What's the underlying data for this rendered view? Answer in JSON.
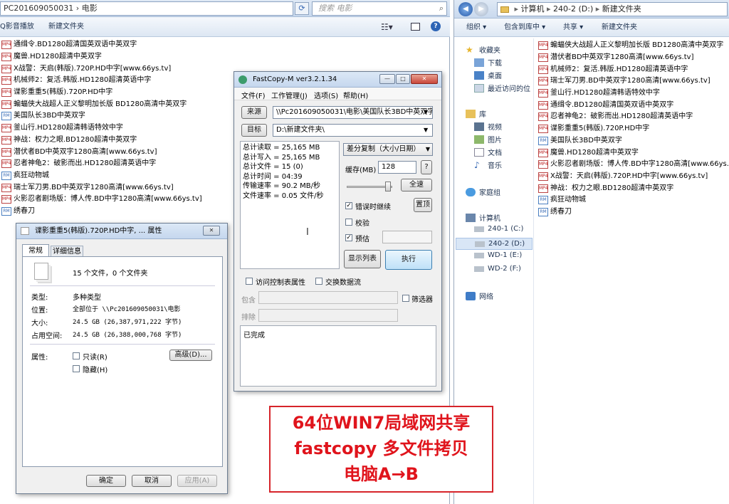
{
  "left_window": {
    "address": "PC201609050031 › 电影",
    "search_placeholder": "搜索 电影",
    "toolbar": {
      "play": "Q影音播放",
      "new_folder": "新建文件夹"
    },
    "files": [
      "通缉令.BD1280超清国英双语中英双字",
      "魔兽.HD1280超清中英双字",
      "X战警：天启(韩版).720P.HD中字[www.66ys.tv]",
      "机械师2：复活.韩版.HD1280超清英语中字",
      "谍影重重5(韩版).720P.HD中字",
      "蝙蝠侠大战超人正义黎明加长版 BD1280高清中英双字",
      "美国队长3BD中英双字",
      "釜山行.HD1280超清韩语特效中字",
      "神战：权力之眼.BD1280超清中英双字",
      "潜伏者BD中英双字1280高清[www.66ys.tv]",
      "忍者神龟2：破影而出.HD1280超清英语中字",
      "疯狂动物城",
      "瑞士军刀男.BD中英双字1280高清[www.66ys.tv]",
      "火影忍者剧场版：博人传.BD中字1280高清[www.66ys.tv]",
      "绣春刀"
    ]
  },
  "right_window": {
    "address": [
      "计算机",
      "240-2 (D:)",
      "新建文件夹"
    ],
    "toolbar": {
      "organize": "组织 ▾",
      "include_library": "包含到库中 ▾",
      "share": "共享 ▾",
      "new_folder": "新建文件夹"
    },
    "nav": {
      "favorites": "收藏夹",
      "download": "下载",
      "desktop": "桌面",
      "recent": "最近访问的位",
      "library": "库",
      "video": "视频",
      "pictures": "图片",
      "documents": "文档",
      "music": "音乐",
      "homegroup": "家庭组",
      "computer": "计算机",
      "drive1": "240-1 (C:)",
      "drive2": "240-2 (D:)",
      "drive3": "WD-1 (E:)",
      "drive4": "WD-2 (F:)",
      "network": "网络"
    },
    "files": [
      "蝙蝠侠大战超人正义黎明加长版 BD1280高清中英双字",
      "潜伏者BD中英双字1280高清[www.66ys.tv]",
      "机械师2：复活.韩版.HD1280超清英语中字",
      "瑞士军刀男.BD中英双字1280高清[www.66ys.tv]",
      "釜山行.HD1280超清韩语特效中字",
      "通缉令.BD1280超清国英双语中英双字",
      "忍者神龟2：破影而出.HD1280超清英语中字",
      "谍影重重5(韩版).720P.HD中字",
      "美国队长3BD中英双字",
      "魔兽.HD1280超清中英双字",
      "火影忍者剧场版：博人传.BD中字1280高清[www.66ys.tv]",
      "X战警：天启(韩版).720P.HD中字[www.66ys.tv]",
      "神战：权力之眼.BD1280超清中英双字",
      "疯狂动物城",
      "绣春刀"
    ]
  },
  "props": {
    "title": "谍影重重5(韩版).720P.HD中字, ... 属性",
    "tabs": [
      "常规",
      "详细信息"
    ],
    "summary": "15 个文件，0 个文件夹",
    "type_label": "类型:",
    "type_value": "多种类型",
    "loc_label": "位置:",
    "loc_value": "全部位于 \\\\Pc201609050031\\电影",
    "size_label": "大小:",
    "size_value": "24.5 GB (26,387,971,222 字节)",
    "disk_label": "占用空间:",
    "disk_value": "24.5 GB (26,388,000,768 字节)",
    "attr_label": "属性:",
    "readonly": "只读(R)",
    "hidden": "隐藏(H)",
    "advanced": "高级(D)...",
    "ok": "确定",
    "cancel": "取消",
    "apply": "应用(A)"
  },
  "fastcopy": {
    "title": "FastCopy-M ver3.2.1.34",
    "menu": [
      "文件(F)",
      "工作管理(J)",
      "选项(S)",
      "帮助(H)"
    ],
    "source_btn": "来源",
    "source_path": "\\\\Pc201609050031\\电影\\美国队长3BD中英双字",
    "dest_btn": "目标",
    "dest_path": "D:\\新建文件夹\\",
    "stats": [
      "总计读取 = 25,165 MB",
      "总计写入 = 25,165 MB",
      "总计文件 = 15 (0)",
      "总计时间 = 04:39",
      "传输速率 = 90.2 MB/秒",
      "文件速率 = 0.05 文件/秒"
    ],
    "mode": "差分复制（大小/日期）",
    "buffer_label": "缓存(MB)",
    "buffer_value": "128",
    "help": "?",
    "fullspeed": "全速",
    "continue_on_error": "错误时继续",
    "top": "置顶",
    "verify": "校验",
    "estimate": "预估",
    "listing": "显示列表",
    "execute": "执行",
    "acl": "访问控制表属性",
    "stream": "交换数据流",
    "include": "包含",
    "exclude": "排除",
    "filter": "筛选器",
    "status": "已完成"
  },
  "banner": {
    "line1": "64位WIN7局域网共享",
    "line2": "fastcopy 多文件拷贝",
    "line3": "电脑A→B"
  },
  "colors": {
    "banner_text": "#e0141c",
    "banner_border": "#d6242a",
    "accent": "#3a6bb5"
  }
}
